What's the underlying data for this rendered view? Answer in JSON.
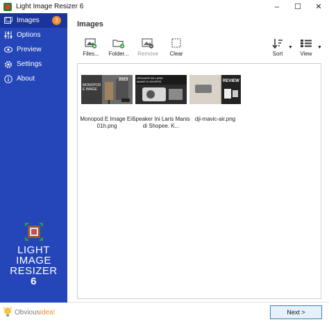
{
  "window": {
    "title": "Light Image Resizer 6",
    "controls": [
      "–",
      "☐",
      "✕"
    ]
  },
  "sidebar": {
    "items": [
      {
        "label": "Images",
        "icon": "images-icon",
        "badge": "3",
        "active": true
      },
      {
        "label": "Options",
        "icon": "sliders-icon"
      },
      {
        "label": "Preview",
        "icon": "eye-icon"
      },
      {
        "label": "Settings",
        "icon": "gear-icon"
      },
      {
        "label": "About",
        "icon": "info-icon"
      }
    ],
    "brand": {
      "line1": "LIGHT",
      "line2": "IMAGE",
      "line3": "RESIZER",
      "line4": "6"
    },
    "footer": {
      "prefix": "Obvious",
      "suffix": "idea!"
    }
  },
  "main": {
    "title": "Images",
    "toolbar": {
      "files": "Files...",
      "folder": "Folder...",
      "remove": "Remove",
      "clear": "Clear",
      "sort": "Sort",
      "view": "View"
    },
    "thumbnails": [
      {
        "caption": "Monopod E Image Ei-01h.png",
        "overlay": "2023"
      },
      {
        "caption": "Speaker Ini Laris Manis di Shopee. K...",
        "overlay": ""
      },
      {
        "caption": "dji-mavic-air.png",
        "overlay": "REVIEW"
      }
    ],
    "next_label": "Next >"
  },
  "colors": {
    "sidebar": "#2446b8",
    "sidebar_active": "#1a359a",
    "badge": "#f28c28",
    "accent_green": "#2e9e3a",
    "next_border": "#3c7fb1"
  }
}
